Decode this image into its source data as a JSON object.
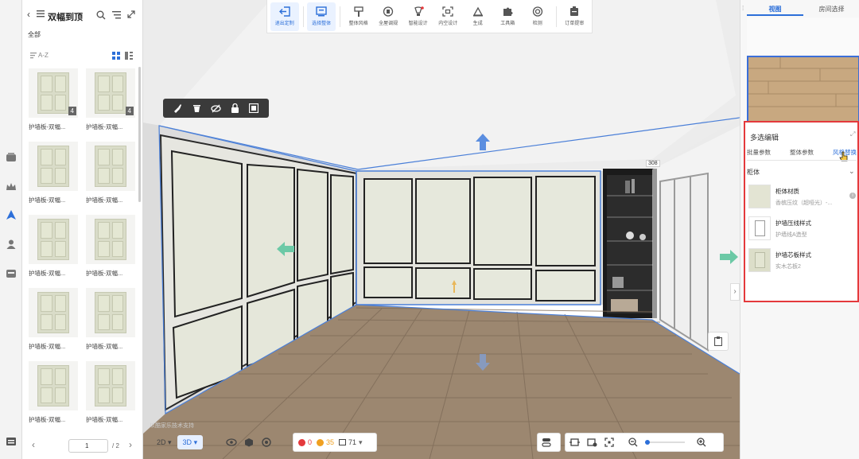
{
  "library": {
    "title": "双幅到顶",
    "all_label": "全部",
    "sort_label": "A-Z",
    "items": [
      {
        "label": "护墙板-双幅...",
        "badge": "4"
      },
      {
        "label": "护墙板-双幅...",
        "badge": "4"
      },
      {
        "label": "护墙板-双幅...",
        "badge": ""
      },
      {
        "label": "护墙板-双幅...",
        "badge": ""
      },
      {
        "label": "护墙板-双幅...",
        "badge": ""
      },
      {
        "label": "护墙板-双幅...",
        "badge": ""
      },
      {
        "label": "护墙板-双幅...",
        "badge": ""
      },
      {
        "label": "护墙板-双幅...",
        "badge": ""
      },
      {
        "label": "护墙板-双幅...",
        "badge": ""
      },
      {
        "label": "护墙板-双幅...",
        "badge": ""
      }
    ],
    "page_current": "1",
    "page_total": "/ 2"
  },
  "toolbar": {
    "items": [
      {
        "label": "退出定制",
        "icon": "exit-icon"
      },
      {
        "label": "选择整体",
        "icon": "select-whole-icon"
      },
      {
        "label": "整体风格",
        "icon": "style-icon"
      },
      {
        "label": "全屋调规",
        "icon": "whole-house-icon"
      },
      {
        "label": "智能设计",
        "icon": "smart-design-icon"
      },
      {
        "label": "内空设计",
        "icon": "inner-space-icon"
      },
      {
        "label": "生成",
        "icon": "generate-icon"
      },
      {
        "label": "工具箱",
        "icon": "toolbox-icon"
      },
      {
        "label": "检测",
        "icon": "detect-icon"
      },
      {
        "label": "订单提审",
        "icon": "order-submit-icon"
      }
    ]
  },
  "viewport": {
    "dimension_label": "308",
    "watermark": "以酷家乐技术支持"
  },
  "bottom_bar": {
    "mode_2d": "2D",
    "mode_3d": "3D",
    "error_count": "0",
    "warning_count": "35",
    "item_count": "71"
  },
  "right_panel": {
    "tabs": [
      "视图",
      "房间选择"
    ],
    "edit": {
      "title": "多选编辑",
      "tabs": [
        "批量参数",
        "整体参数",
        "风格替换"
      ],
      "section": "柜体",
      "props": [
        {
          "title": "柜体材质",
          "value": "香槟压纹（超哑光）-..."
        },
        {
          "title": "护墙压线样式",
          "value": "护墙线A造型"
        },
        {
          "title": "护墙芯板样式",
          "value": "实木芯板2"
        }
      ]
    }
  },
  "colors": {
    "accent": "#2c6fd9",
    "highlight": "#e4393c",
    "wall_panel": "#dde0d2",
    "floor": "#9c8770"
  }
}
